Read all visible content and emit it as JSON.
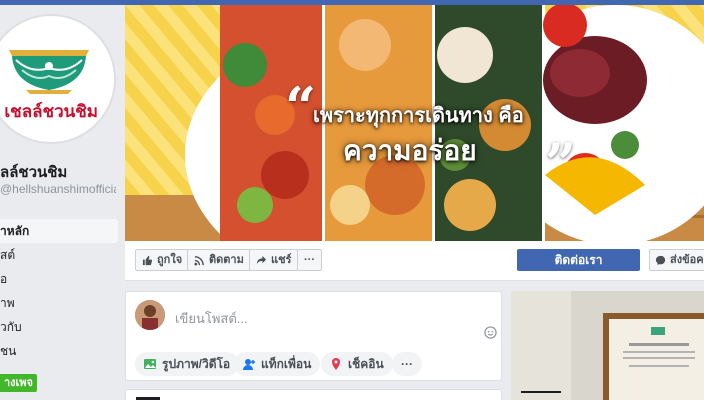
{
  "page": {
    "name": "ลล์ชวนชิม",
    "handle": "@hellshuanshimofficial",
    "logo_text": "เชลล์ชวนชิม",
    "brand_color": "#c8102e"
  },
  "nav": {
    "items": [
      {
        "label": "าหลัก",
        "active": true
      },
      {
        "label": "สต์"
      },
      {
        "label": "อ"
      },
      {
        "label": "าพ"
      },
      {
        "label": "วกับ"
      },
      {
        "label": "ชน"
      }
    ],
    "create_label": "างเพจ"
  },
  "cover": {
    "line1": "เพราะทุกการเดินทาง คือ",
    "line2": "ความอร่อย",
    "quote_open": "“",
    "quote_close": "”"
  },
  "actions": {
    "like": "ถูกใจ",
    "follow": "ติดตาม",
    "share": "แชร์",
    "more": "···",
    "contact": "ติดต่อเรา",
    "message": "ส่งข้อค"
  },
  "composer": {
    "placeholder": "เขียนโพสต์...",
    "photo_video": "รูปภาพ/วิดีโอ",
    "tag_friends": "แท็กเพื่อน",
    "check_in": "เช็คอิน",
    "more": "···"
  },
  "colors": {
    "accent": "#4267b2",
    "create_button": "#42b72a",
    "background": "#e9ebee"
  }
}
